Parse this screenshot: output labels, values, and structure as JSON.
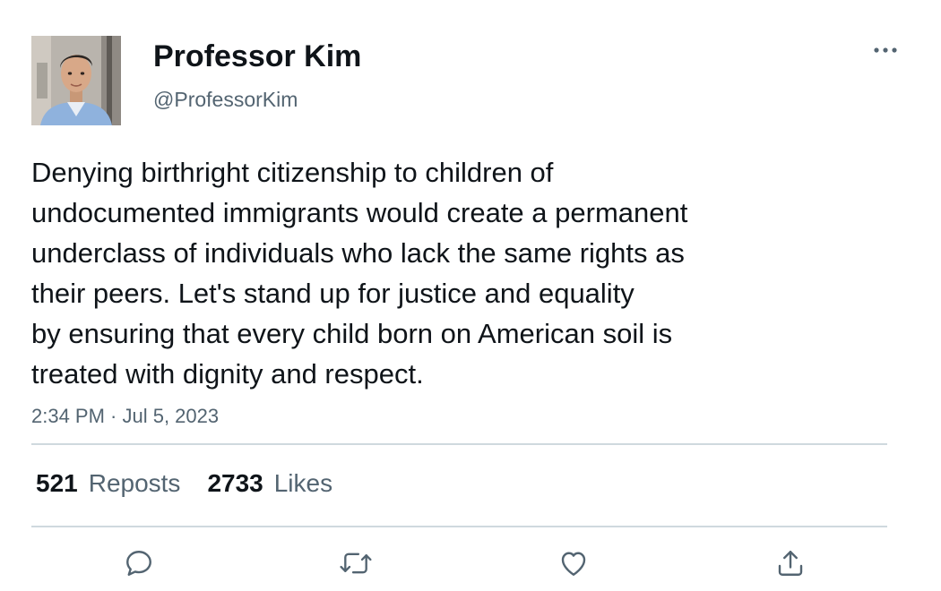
{
  "author": {
    "display_name": "Professor Kim",
    "handle": "@ProfessorKim",
    "avatar_icon": "profile-photo"
  },
  "tweet": {
    "lines": [
      "Denying birthright citizenship to children of",
      "undocumented immigrants would create a permanent",
      "underclass of individuals who lack the same rights as",
      "their peers. Let's stand up for justice and equality",
      "by ensuring that every child born on American soil is",
      "treated with dignity and respect."
    ],
    "timestamp": "2:34 PM · Jul 5, 2023"
  },
  "stats": {
    "reposts_count": "521",
    "reposts_label": "Reposts",
    "likes_count": "2733",
    "likes_label": "Likes"
  },
  "actions": {
    "more_icon": "more-horizontal-icon",
    "reply_icon": "reply-icon",
    "repost_icon": "repost-icon",
    "like_icon": "heart-icon",
    "share_icon": "share-icon"
  },
  "colors": {
    "text_primary": "#0f1419",
    "text_secondary": "#536471",
    "divider": "#cfd9de"
  }
}
